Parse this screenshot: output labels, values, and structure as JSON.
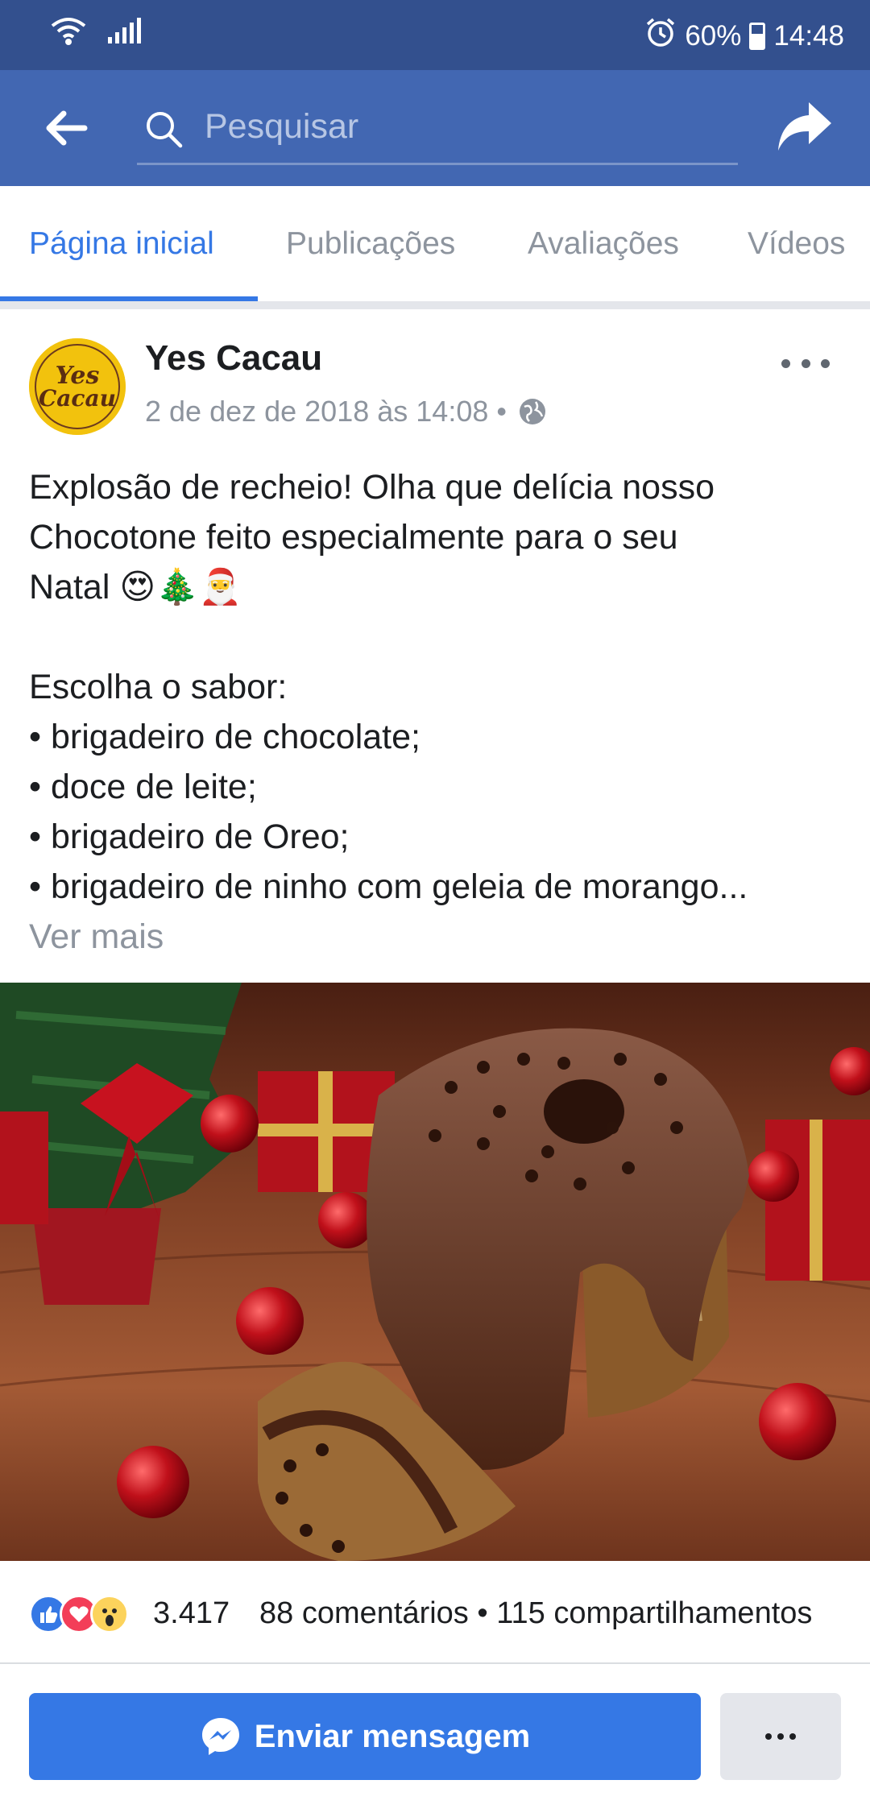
{
  "status_bar": {
    "battery": "60%",
    "time": "14:48",
    "battery_level": 0.6
  },
  "search": {
    "placeholder": "Pesquisar"
  },
  "tabs": [
    {
      "label": "Página inicial",
      "active": true
    },
    {
      "label": "Publicações",
      "active": false
    },
    {
      "label": "Avaliações",
      "active": false
    },
    {
      "label": "Vídeos",
      "active": false
    }
  ],
  "post": {
    "page_name": "Yes Cacau",
    "avatar_text": "Yes Cacau",
    "timestamp": "2 de dez de 2018 às 14:08 •",
    "text_lines": [
      "Explosão de recheio! Olha que delícia nosso",
      "Chocotone feito especialmente para o seu",
      "Natal 😍🎄🎅",
      "",
      "Escolha o sabor:",
      "• brigadeiro de chocolate;",
      "• doce de leite;",
      "• brigadeiro de Oreo;",
      "• brigadeiro de ninho com geleia de morango..."
    ],
    "see_more": "Ver mais"
  },
  "reactions": {
    "count": "3.417",
    "meta": "88 comentários • 115 compartilhamentos"
  },
  "actions": {
    "send_message": "Enviar mensagem"
  },
  "colors": {
    "status_bar": "#33508e",
    "header": "#4267b2",
    "accent": "#3578e5"
  }
}
